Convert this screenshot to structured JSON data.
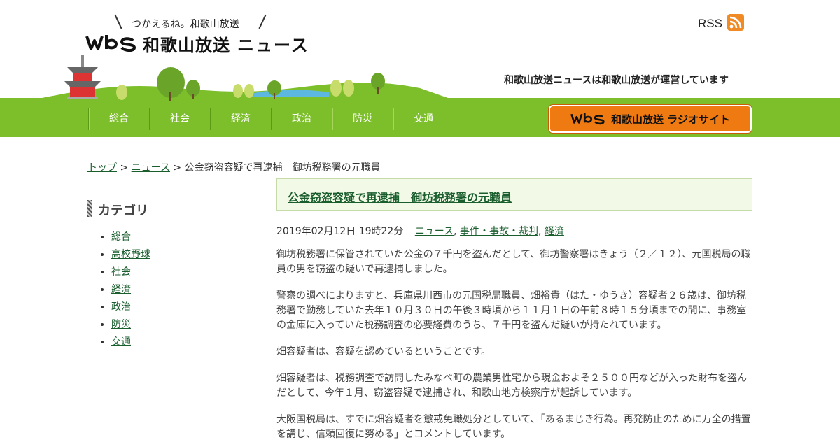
{
  "header": {
    "tagline": "つかえるね。和歌山放送",
    "logo_mark": "wbs",
    "logo_title": "和歌山放送",
    "logo_news": "ニュース",
    "rss_label": "RSS",
    "operated_by": "和歌山放送ニュースは和歌山放送が運営しています",
    "radio_site_label": "和歌山放送 ラジオサイト",
    "colors": {
      "green": "#7cbf2a",
      "orange": "#f07a12"
    }
  },
  "nav": {
    "items": [
      "総合",
      "社会",
      "経済",
      "政治",
      "防災",
      "交通"
    ]
  },
  "breadcrumb": {
    "top": "トップ",
    "sep": " > ",
    "news": "ニュース",
    "current": "公金窃盗容疑で再逮捕　御坊税務署の元職員"
  },
  "sidebar": {
    "title": "カテゴリ",
    "items": [
      "総合",
      "高校野球",
      "社会",
      "経済",
      "政治",
      "防災",
      "交通"
    ]
  },
  "article": {
    "title": "公金窃盗容疑で再逮捕　御坊税務署の元職員",
    "date": "2019年02月12日 19時22分",
    "categories": [
      "ニュース",
      "事件・事故・裁判",
      "経済"
    ],
    "paragraphs": [
      "御坊税務署に保管されていた公金の７千円を盗んだとして、御坊警察署はきょう（２／１２）、元国税局の職員の男を窃盗の疑いで再逮捕しました。",
      "警察の調べによりますと、兵庫県川西市の元国税局職員、畑裕貴（はた・ゆうき）容疑者２６歳は、御坊税務署で勤務していた去年１０月３０日の午後３時頃から１１月１日の午前８時１５分頃までの間に、事務室の金庫に入っていた税務調査の必要経費のうち、７千円を盗んだ疑いが持たれています。",
      "畑容疑者は、容疑を認めているということです。",
      "畑容疑者は、税務調査で訪問したみなべ町の農業男性宅から現金およそ２５００円などが入った財布を盗んだとして、今年１月、窃盗容疑で逮捕され、和歌山地方検察庁が起訴しています。",
      "大阪国税局は、すでに畑容疑者を懲戒免職処分としていて、「あるまじき行為。再発防止のために万全の措置を講じ、信頼回復に努める」とコメントしています。"
    ]
  }
}
